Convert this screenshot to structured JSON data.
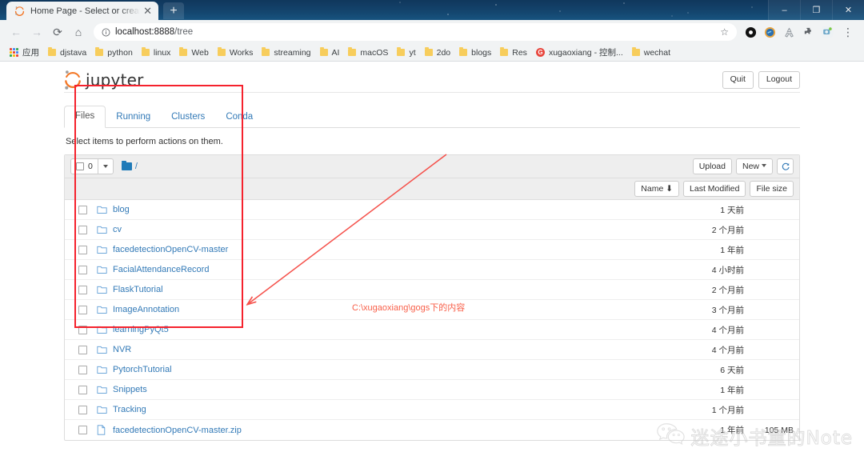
{
  "browser": {
    "tab": {
      "title": "Home Page - Select or create",
      "favicon": "jupyter-favicon",
      "close": "✕"
    },
    "new_tab_label": "+",
    "window_controls": {
      "minimize": "–",
      "maximize": "❐",
      "close": "✕"
    },
    "nav": {
      "back": "←",
      "forward": "→",
      "reload": "⟳",
      "home": "⌂"
    },
    "omnibox": {
      "info_icon": "info-circle-icon",
      "host": "localhost:8888",
      "path": "/tree",
      "star": "☆"
    },
    "extensions": [
      "extension-dark-circle",
      "extension-globe",
      "extension-recycle",
      "extension-puzzle",
      "extension-camera"
    ],
    "menu": "⋮",
    "bookmarks": [
      {
        "label": "应用",
        "icon": "apps-grid-icon"
      },
      {
        "label": "djstava",
        "icon": "folder-icon"
      },
      {
        "label": "python",
        "icon": "folder-icon"
      },
      {
        "label": "linux",
        "icon": "folder-icon"
      },
      {
        "label": "Web",
        "icon": "folder-icon"
      },
      {
        "label": "Works",
        "icon": "folder-icon"
      },
      {
        "label": "streaming",
        "icon": "folder-icon"
      },
      {
        "label": "AI",
        "icon": "folder-icon"
      },
      {
        "label": "macOS",
        "icon": "folder-icon"
      },
      {
        "label": "yt",
        "icon": "folder-icon"
      },
      {
        "label": "2do",
        "icon": "folder-icon"
      },
      {
        "label": "blogs",
        "icon": "folder-icon"
      },
      {
        "label": "Res",
        "icon": "folder-icon"
      },
      {
        "label": "xugaoxiang - 控制...",
        "icon": "gogs-icon"
      },
      {
        "label": "wechat",
        "icon": "folder-icon"
      }
    ]
  },
  "jupyter": {
    "logo_text": "jupyter",
    "quit_label": "Quit",
    "logout_label": "Logout",
    "tabs": [
      {
        "label": "Files",
        "active": true
      },
      {
        "label": "Running",
        "active": false
      },
      {
        "label": "Clusters",
        "active": false
      },
      {
        "label": "Conda",
        "active": false
      }
    ],
    "select_note": "Select items to perform actions on them.",
    "toolbar": {
      "selected_count": "0",
      "breadcrumb_root": "/",
      "upload_label": "Upload",
      "new_label": "New",
      "refresh_icon": "refresh-icon"
    },
    "sort": {
      "name_label": "Name",
      "name_sort_arrow": "⬇",
      "last_modified_label": "Last Modified",
      "file_size_label": "File size"
    },
    "files": [
      {
        "name": "blog",
        "type": "folder",
        "modified": "1 天前",
        "size": ""
      },
      {
        "name": "cv",
        "type": "folder",
        "modified": "2 个月前",
        "size": ""
      },
      {
        "name": "facedetectionOpenCV-master",
        "type": "folder",
        "modified": "1 年前",
        "size": ""
      },
      {
        "name": "FacialAttendanceRecord",
        "type": "folder",
        "modified": "4 小时前",
        "size": ""
      },
      {
        "name": "FlaskTutorial",
        "type": "folder",
        "modified": "2 个月前",
        "size": ""
      },
      {
        "name": "ImageAnnotation",
        "type": "folder",
        "modified": "3 个月前",
        "size": ""
      },
      {
        "name": "learningPyQt5",
        "type": "folder",
        "modified": "4 个月前",
        "size": ""
      },
      {
        "name": "NVR",
        "type": "folder",
        "modified": "4 个月前",
        "size": ""
      },
      {
        "name": "PytorchTutorial",
        "type": "folder",
        "modified": "6 天前",
        "size": ""
      },
      {
        "name": "Snippets",
        "type": "folder",
        "modified": "1 年前",
        "size": ""
      },
      {
        "name": "Tracking",
        "type": "folder",
        "modified": "1 个月前",
        "size": ""
      },
      {
        "name": "facedetectionOpenCV-master.zip",
        "type": "file",
        "modified": "1 年前",
        "size": "105 MB"
      }
    ]
  },
  "annotations": {
    "callout_text": "C:\\xugaoxiang\\gogs下的内容",
    "highlight_color": "#f5222d",
    "arrow_color": "#f5504a"
  },
  "watermark": {
    "text": "迷途小书童的Note",
    "icon": "wechat-icon"
  }
}
